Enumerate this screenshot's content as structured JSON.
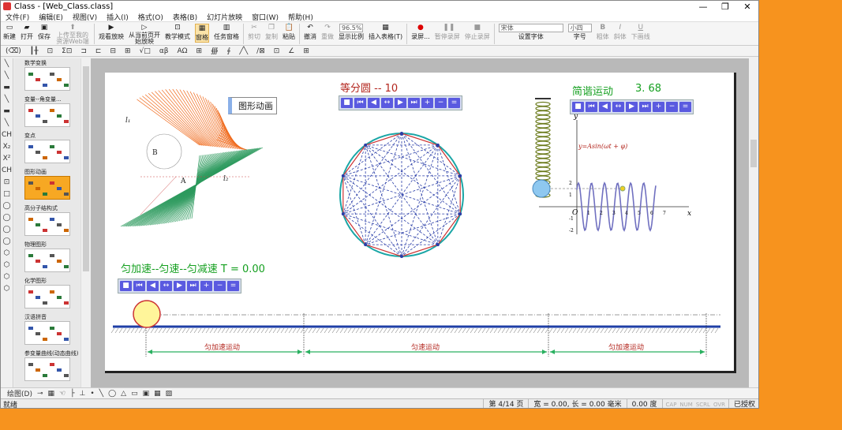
{
  "window": {
    "title": "Class - [Web_Class.class]"
  },
  "menu": [
    "文件(F)",
    "编辑(E)",
    "视图(V)",
    "插入(I)",
    "格式(O)",
    "表格(B)",
    "幻灯片放映",
    "窗口(W)",
    "帮助(H)"
  ],
  "toolbar": {
    "new": "新建",
    "open": "打开",
    "save": "保存",
    "upload": "上传至我的资源Web端",
    "watch": "观看放映",
    "from_current": "从当前页开始放映",
    "teach_mode": "教学模式",
    "pane": "窗格",
    "task_pane": "任务窗格",
    "cut": "剪切",
    "copy": "复制",
    "paste": "粘贴",
    "undo": "撤消",
    "redo": "重做",
    "zoom_value": "96.5%",
    "zoom_label": "显示比例",
    "insert_table": "插入表格(T)",
    "record": "录屏...",
    "pause_record": "暂停录屏",
    "stop_record": "停止录屏",
    "font_name": "宋体",
    "font_setting": "设置字体",
    "font_size": "小四",
    "size_label": "字号",
    "bold": "粗体",
    "italic": "斜体",
    "underline": "下画线"
  },
  "toolbar2": [
    "(⌫)",
    "┃╂",
    "⊡",
    "Σ⊡",
    "⊐",
    "⊏",
    "⊟",
    "⊞",
    "√□",
    "αβ",
    "ΑΩ",
    "⊞",
    "∰",
    "∮",
    "╱╲",
    "/⊠",
    "⊡",
    "∠",
    "⊞"
  ],
  "left_tools": [
    "╲",
    "╲",
    "▬",
    "╲",
    "▬",
    "╲",
    "CH",
    "X₂",
    "X²",
    "CH",
    "⊡",
    "□",
    "◯",
    "◯",
    "◯",
    "◯",
    "⬡",
    "⬡",
    "⬡",
    "⬡"
  ],
  "slides": [
    {
      "label": "数学变换",
      "selected": false
    },
    {
      "label": "变量--角变量...",
      "selected": false
    },
    {
      "label": "变点",
      "selected": false
    },
    {
      "label": "图形动画",
      "selected": true
    },
    {
      "label": "高分子结构式",
      "selected": false
    },
    {
      "label": "物理图形",
      "selected": false
    },
    {
      "label": "化学图形",
      "selected": false
    },
    {
      "label": "汉语拼音",
      "selected": false
    },
    {
      "label": "参变量曲线(动态曲线)",
      "selected": false
    }
  ],
  "slide": {
    "button_label": "图形动画",
    "equal_circle": "等分圆 -- 10",
    "shm_title": "简谐运动",
    "shm_value": "3. 68",
    "shm_formula": "y=Asin(ωt + φ)",
    "shm_xlabel": "x",
    "shm_ylabel": "y",
    "shm_origin": "O",
    "shm_xticks": [
      "1",
      "2",
      "3",
      "4",
      "5",
      "6",
      "7"
    ],
    "shm_yticks": [
      "2",
      "1",
      "-1",
      "-2"
    ],
    "motion_title": "匀加速--匀速--匀减速 T = 0.00",
    "seg1": "匀加速运动",
    "seg2": "匀速运动",
    "seg3": "匀加速运动",
    "labels": {
      "l1": "l₁",
      "l2": "l₂",
      "a": "A",
      "b": "B"
    },
    "ctl_glyphs": [
      "■",
      "⏮",
      "◀",
      "↔",
      "▶",
      "⏭",
      "+",
      "−",
      "="
    ]
  },
  "bottombar": [
    "绘图(D)",
    "⊸",
    "▦",
    "☜",
    "├",
    "⊥",
    "•",
    "╲",
    "◯",
    "△",
    "▭",
    "▣",
    "▦",
    "▨"
  ],
  "status": {
    "left": "就绪",
    "page": "第 4/14 页",
    "dims": "宽 = 0.00, 长 = 0.00 毫米",
    "deg": "0.00 度",
    "flags": [
      "CAP",
      "NUM",
      "SCRL",
      "OVR"
    ],
    "auth": "已授权"
  },
  "colors": {
    "accent": "#f7931e",
    "spiral_orange": "#f06a1c",
    "spiral_green": "#2d9a5e",
    "blue_line": "#1f3fa6",
    "green_text": "#15a020",
    "red_text": "#b3261e"
  }
}
